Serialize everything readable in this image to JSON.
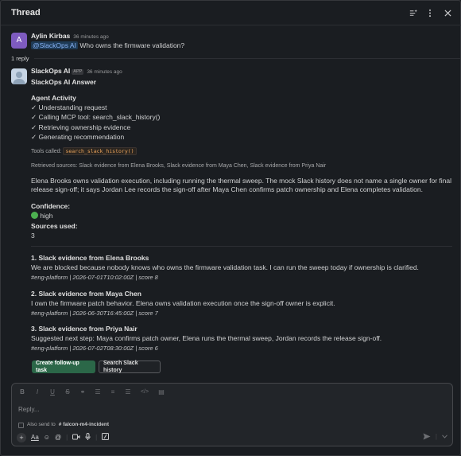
{
  "header": {
    "title": "Thread"
  },
  "root_message": {
    "avatar_letter": "A",
    "author": "Aylin Kirbas",
    "timestamp": "36 minutes ago",
    "mention": "@SlackOps AI",
    "text": "Who owns the firmware validation?"
  },
  "reply_count": "1 reply",
  "bot_message": {
    "author": "SlackOps AI",
    "badge": "APP",
    "timestamp": "36 minutes ago",
    "heading": "SlackOps AI Answer",
    "activity_title": "Agent Activity",
    "activity_steps": [
      "✓ Understanding request",
      "✓ Calling MCP tool: search_slack_history()",
      "✓ Retrieving ownership evidence",
      "✓ Generating recommendation"
    ],
    "tools_label": "Tools called:",
    "tools_value": "search_slack_history()",
    "sources_line": "Retrieved sources: Slack evidence from Elena Brooks, Slack evidence from Maya Chen, Slack evidence from Priya Nair",
    "answer": "Elena Brooks owns validation execution, including running the thermal sweep. The mock Slack history does not name a single owner for final release sign-off; it says Jordan Lee records the sign-off after Maya Chen confirms patch ownership and Elena completes validation.",
    "confidence_label": "Confidence:",
    "confidence_icon": "🟢",
    "confidence_value": "high",
    "sources_used_label": "Sources used:",
    "sources_used_value": "3",
    "evidence": [
      {
        "title": "1. Slack evidence from Elena Brooks",
        "text": "We are blocked because nobody knows who owns the firmware validation task. I can run the sweep today if ownership is clarified.",
        "meta": "#eng-platform | 2026-07-01T10:02:00Z | score 8"
      },
      {
        "title": "2. Slack evidence from Maya Chen",
        "text": "I own the firmware patch behavior. Elena owns validation execution once the sign-off owner is explicit.",
        "meta": "#eng-platform | 2026-06-30T16:45:00Z | score 7"
      },
      {
        "title": "3. Slack evidence from Priya Nair",
        "text": "Suggested next step: Maya confirms patch owner, Elena runs the thermal sweep, Jordan records the release sign-off.",
        "meta": "#eng-platform | 2026-07-02T08:30:00Z | score 6"
      }
    ],
    "button_primary": "Create follow-up task",
    "button_secondary": "Search Slack history"
  },
  "composer": {
    "placeholder": "Reply...",
    "also_send_label": "Also send to",
    "channel": "# falcon-m4-incident",
    "format_icons": [
      "B",
      "I",
      "U",
      "S",
      "⚭",
      "☰",
      "≡",
      "☰",
      "</>",
      "▤"
    ]
  },
  "colors": {
    "background": "#1a1d21",
    "primary_button": "#2b6748",
    "avatar_a": "#7e5bbf",
    "mention_bg": "#1e3a55"
  }
}
